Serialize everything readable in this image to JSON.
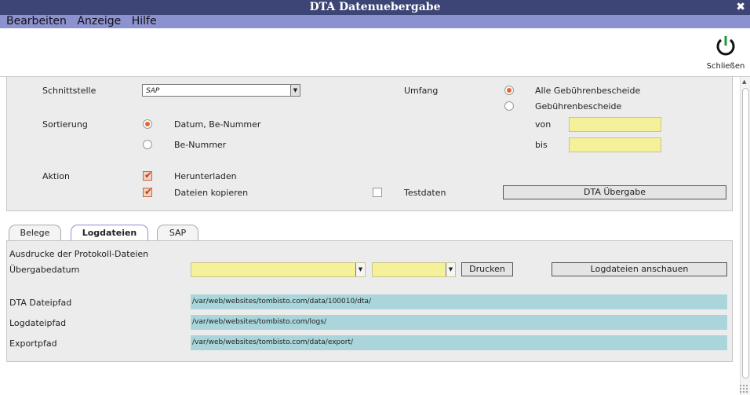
{
  "window": {
    "title": "DTA Datenuebergabe",
    "close_glyph": "✖"
  },
  "menu": [
    "Bearbeiten",
    "Anzeige",
    "Hilfe"
  ],
  "toolbar": {
    "close_label": "Schließen"
  },
  "form": {
    "schnittstelle_label": "Schnittstelle",
    "schnittstelle_value": "SAP",
    "sortierung_label": "Sortierung",
    "sort_opt1": "Datum, Be-Nummer",
    "sort_opt2": "Be-Nummer",
    "aktion_label": "Aktion",
    "aktion_opt1": "Herunterladen",
    "aktion_opt2": "Dateien kopieren",
    "umfang_label": "Umfang",
    "umfang_opt1": "Alle Gebührenbescheide",
    "umfang_opt2": "Gebührenbescheide",
    "von_label": "von",
    "bis_label": "bis",
    "testdaten_label": "Testdaten",
    "dta_button": "DTA Übergabe"
  },
  "tabs": [
    "Belege",
    "Logdateien",
    "SAP"
  ],
  "log": {
    "heading": "Ausdrucke der Protokoll-Dateien",
    "uebergabedatum_label": "Übergabedatum",
    "print_button": "Drucken",
    "view_button": "Logdateien anschauen",
    "dta_path_label": "DTA Dateipfad",
    "dta_path": "/var/web/websites/tombisto.com/data/100010/dta/",
    "log_path_label": "Logdateipfad",
    "log_path": "/var/web/websites/tombisto.com/logs/",
    "export_path_label": "Exportpfad",
    "export_path": "/var/web/websites/tombisto.com/data/export/"
  }
}
